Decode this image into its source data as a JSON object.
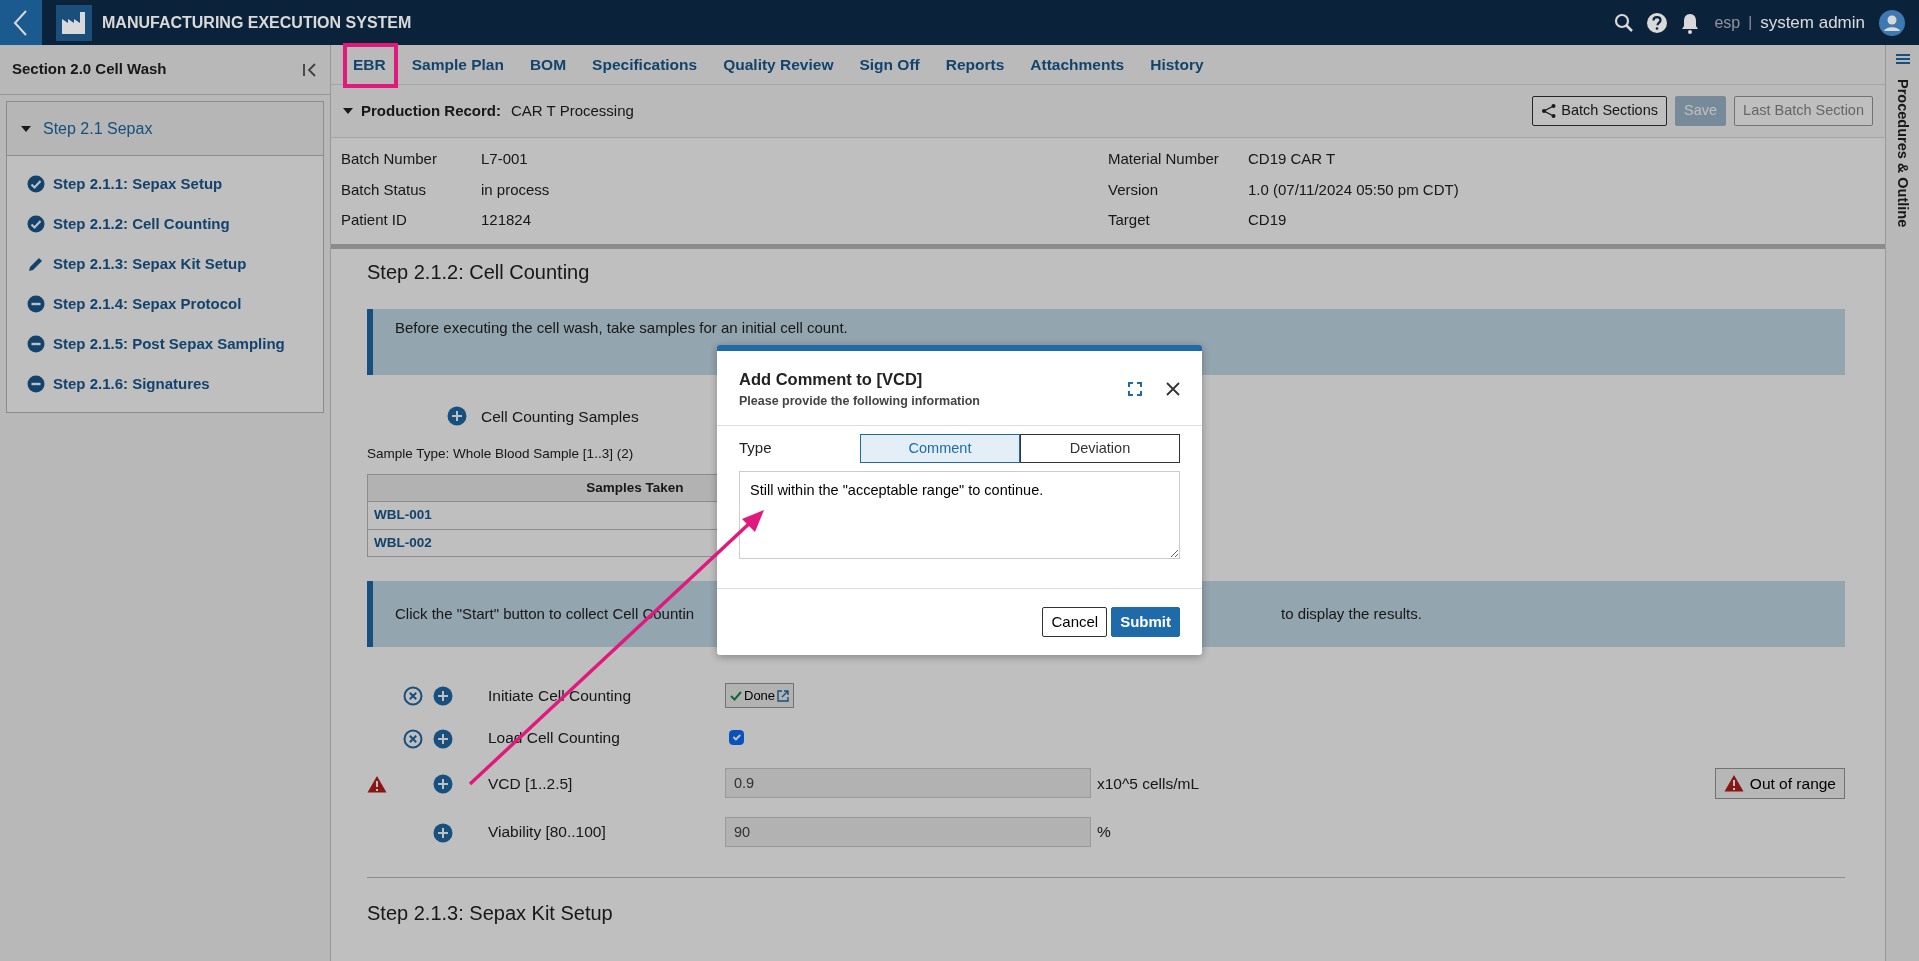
{
  "app": {
    "title": "MANUFACTURING EXECUTION SYSTEM",
    "language": "esp",
    "separator": "|",
    "user": "system admin"
  },
  "sidebar": {
    "title": "Section 2.0 Cell Wash",
    "group": {
      "label": "Step 2.1 Sepax",
      "expanded": true,
      "children": [
        {
          "label": "Step 2.1.1: Sepax Setup",
          "kind": "done"
        },
        {
          "label": "Step 2.1.2: Cell Counting",
          "kind": "done"
        },
        {
          "label": "Step 2.1.3: Sepax Kit Setup",
          "kind": "editing"
        },
        {
          "label": "Step 2.1.4: Sepax Protocol",
          "kind": "pending"
        },
        {
          "label": "Step 2.1.5: Post Sepax Sampling",
          "kind": "pending"
        },
        {
          "label": "Step 2.1.6: Signatures",
          "kind": "pending"
        }
      ]
    }
  },
  "tabs": [
    {
      "label": "EBR",
      "selected": true,
      "highlighted": true
    },
    {
      "label": "Sample Plan",
      "selected": false,
      "highlighted": false
    },
    {
      "label": "BOM",
      "selected": false,
      "highlighted": false
    },
    {
      "label": "Specifications",
      "selected": false,
      "highlighted": false
    },
    {
      "label": "Quality Review",
      "selected": false,
      "highlighted": false
    },
    {
      "label": "Sign Off",
      "selected": false,
      "highlighted": false
    },
    {
      "label": "Reports",
      "selected": false,
      "highlighted": false
    },
    {
      "label": "Attachments",
      "selected": false,
      "highlighted": false
    },
    {
      "label": "History",
      "selected": false,
      "highlighted": false
    }
  ],
  "record": {
    "label": "Production Record:",
    "value": "CAR T Processing",
    "expanded": true,
    "buttons": [
      {
        "label": "Batch Sections",
        "kind": "share",
        "disabled": false
      },
      {
        "label": "Save",
        "kind": "primary",
        "disabled": true
      },
      {
        "label": "Last Batch Section",
        "kind": "outline",
        "disabled": true
      }
    ]
  },
  "info_left": [
    {
      "label": "Batch Number",
      "value": "L7-001"
    },
    {
      "label": "Batch Status",
      "value": "in process"
    },
    {
      "label": "Patient ID",
      "value": "121824"
    }
  ],
  "info_right": [
    {
      "label": "Material Number",
      "value": "CD19 CAR T"
    },
    {
      "label": "Version",
      "value": "1.0 (07/11/2024 05:50 pm CDT)"
    },
    {
      "label": "Target",
      "value": "CD19"
    }
  ],
  "step": {
    "title": "Step 2.1.2: Cell Counting",
    "note_1": "Before executing the cell wash, take samples for an initial cell count.",
    "samples": {
      "add_label": "Cell Counting Samples",
      "sample_type": "Sample Type: Whole Blood Sample [1..3] (2)",
      "columns": [
        "Samples Taken"
      ],
      "rows": [
        "WBL-001",
        "WBL-002"
      ]
    },
    "note_2_start": "Click the \"Start\" button to collect Cell Countin",
    "note_2_end": "to display the results.",
    "fields": [
      {
        "kind": "done-button",
        "label": "Initiate Cell Counting",
        "removable": true,
        "warning": false,
        "value": "Done"
      },
      {
        "kind": "checkbox",
        "label": "Load Cell Counting",
        "removable": true,
        "warning": false,
        "checked": true
      },
      {
        "kind": "number",
        "label": "VCD [1..2.5]",
        "removable": false,
        "warning": true,
        "value": "0.9",
        "unit": "x10^5 cells/mL",
        "alert": "Out of range"
      },
      {
        "kind": "number",
        "label": "Viability [80..100]",
        "removable": false,
        "warning": false,
        "value": "90",
        "unit": "%"
      }
    ]
  },
  "next_step": "Step 2.1.3: Sepax Kit Setup",
  "rail": {
    "title": "Procedures & Outline"
  },
  "modal": {
    "title": "Add Comment to [VCD]",
    "subtitle": "Please provide the following information",
    "type_label": "Type",
    "types": [
      {
        "label": "Comment",
        "selected": true
      },
      {
        "label": "Deviation",
        "selected": false
      }
    ],
    "comment": "Still within the \"acceptable range\" to continue.",
    "buttons": [
      {
        "label": "Cancel",
        "kind": "secondary"
      },
      {
        "label": "Submit",
        "kind": "primary"
      }
    ]
  }
}
